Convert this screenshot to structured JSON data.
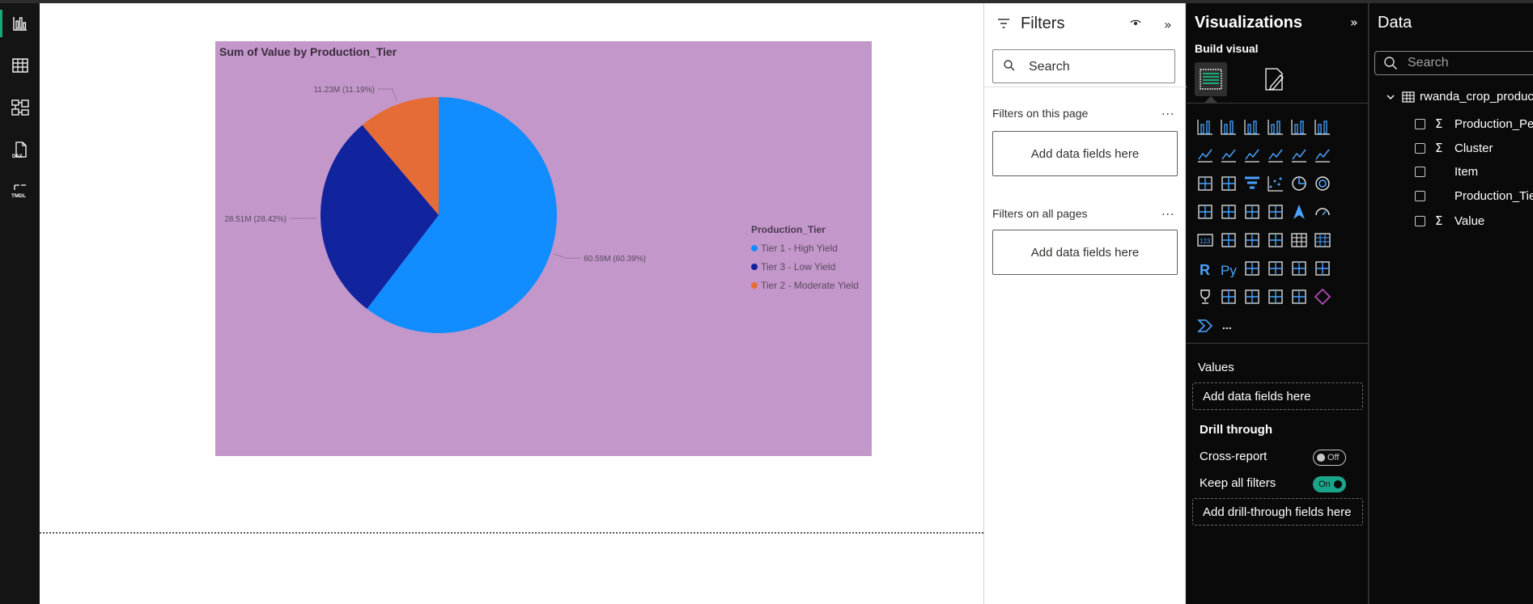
{
  "rail": {
    "items": [
      {
        "name": "report-view-icon",
        "label": ""
      },
      {
        "name": "table-view-icon",
        "label": ""
      },
      {
        "name": "model-view-icon",
        "label": ""
      },
      {
        "name": "dax-query-icon",
        "label": "DAX"
      },
      {
        "name": "tmdl-view-icon",
        "label": "TMDL"
      }
    ]
  },
  "visual": {
    "title": "Sum of Value by Production_Tier",
    "legend_title": "Production_Tier",
    "background": "#c397c9"
  },
  "chart_data": {
    "type": "pie",
    "title": "Sum of Value by Production_Tier",
    "legend_title": "Production_Tier",
    "legend_position": "right",
    "categories": [
      "Tier 1 - High Yield",
      "Tier 3 - Low Yield",
      "Tier 2 - Moderate Yield"
    ],
    "values": [
      60.59,
      28.51,
      11.23
    ],
    "percents": [
      60.39,
      28.42,
      11.19
    ],
    "data_labels": [
      "60.59M (60.39%)",
      "28.51M (28.42%)",
      "11.23M (11.19%)"
    ],
    "colors": [
      "#118dff",
      "#12239e",
      "#e66c37"
    ]
  },
  "filters": {
    "title": "Filters",
    "search_placeholder": "Search",
    "on_this_page": "Filters on this page",
    "on_all_pages": "Filters on all pages",
    "add_fields": "Add data fields here",
    "more": "..."
  },
  "viz": {
    "title": "Visualizations",
    "build_visual": "Build visual",
    "values_label": "Values",
    "add_data_fields": "Add data fields here",
    "drill_through": "Drill through",
    "cross_report": "Cross-report",
    "cross_report_state": "Off",
    "keep_all_filters": "Keep all filters",
    "keep_all_filters_state": "On",
    "add_drill_fields": "Add drill-through fields here",
    "more_visuals": "..."
  },
  "data_pane": {
    "title": "Data",
    "search_placeholder": "Search",
    "table_name": "rwanda_crop_product",
    "fields": [
      {
        "name": "Production_Per",
        "sigma": true
      },
      {
        "name": "Cluster",
        "sigma": true
      },
      {
        "name": "Item",
        "sigma": false
      },
      {
        "name": "Production_Tie",
        "sigma": false
      },
      {
        "name": "Value",
        "sigma": true
      }
    ]
  }
}
